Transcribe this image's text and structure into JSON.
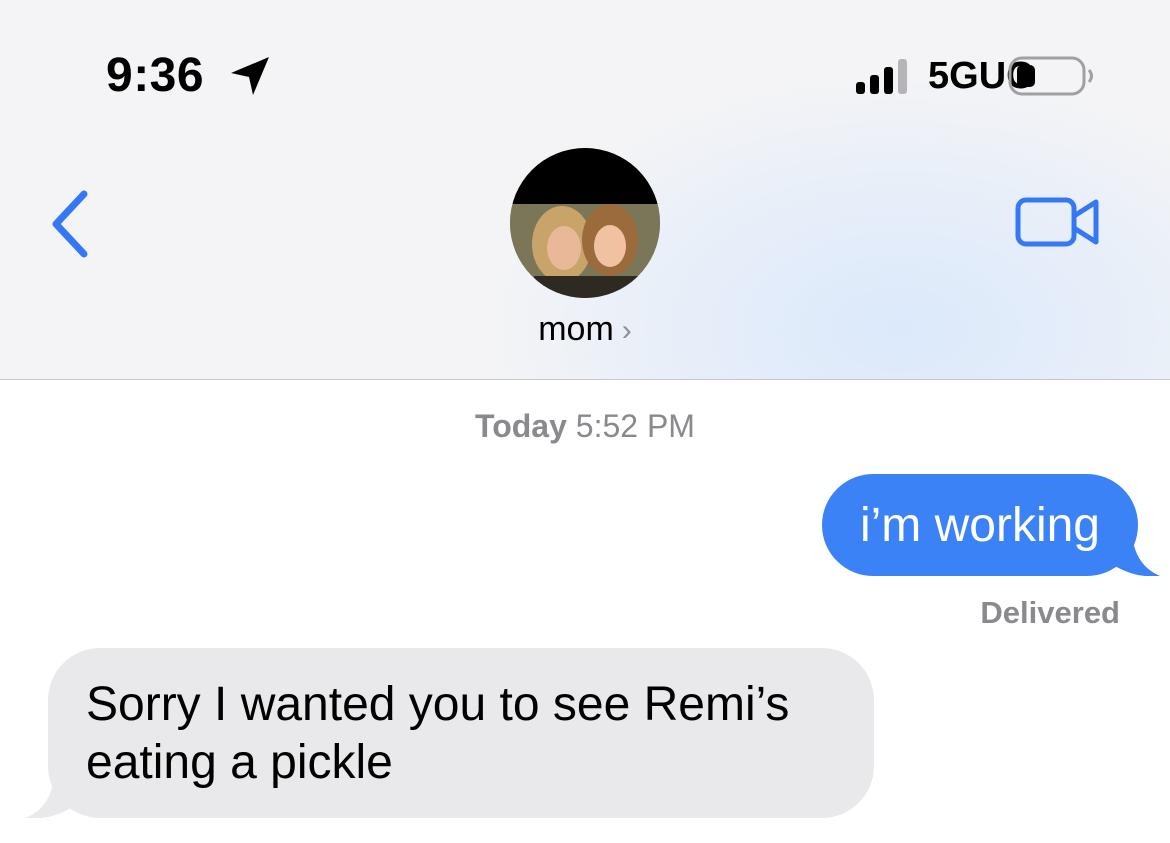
{
  "status_bar": {
    "time": "9:36",
    "network": "5GUC",
    "location_icon": "location-arrow-icon",
    "signal_icon": "cellular-signal-icon",
    "battery_icon": "battery-icon",
    "signal_bars_filled": 3,
    "battery_level": 0.2
  },
  "header": {
    "contact_name": "mom",
    "chevron": "›",
    "back_icon": "chevron-left-icon",
    "video_icon": "video-camera-icon",
    "accent_color": "#3478f6"
  },
  "conversation": {
    "timestamp_day": "Today",
    "timestamp_time": "5:52 PM",
    "messages": [
      {
        "direction": "outgoing",
        "text": "i’m working",
        "status": "Delivered",
        "color": "#3b82f6"
      },
      {
        "direction": "incoming",
        "text": "Sorry I wanted you to see Remi’s eating a pickle",
        "color": "#e9e9eb"
      }
    ]
  }
}
